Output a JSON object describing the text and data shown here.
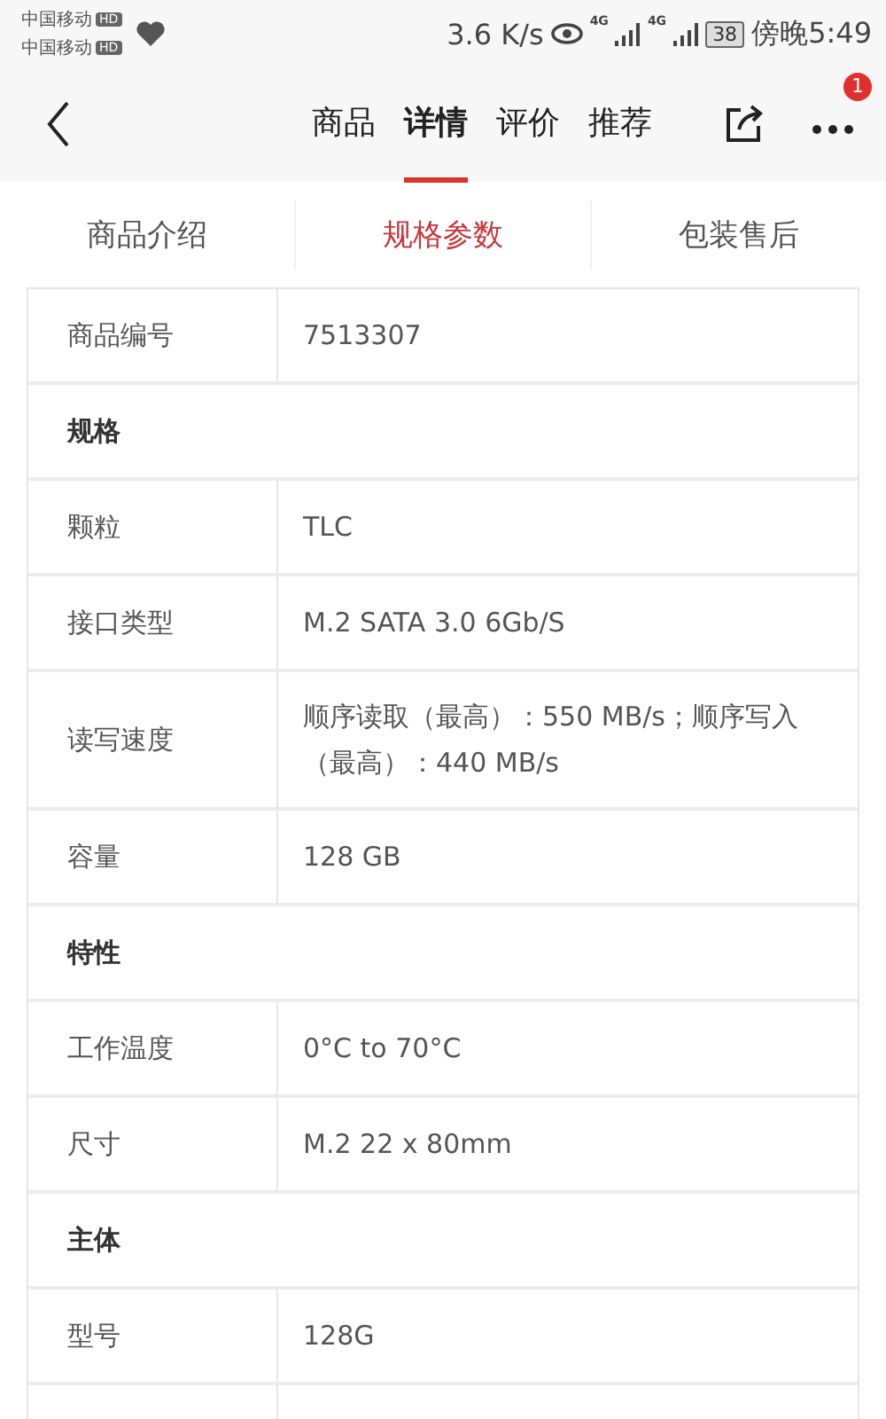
{
  "status_bar": {
    "carriers": [
      {
        "name": "中国移动",
        "badge": "HD"
      },
      {
        "name": "中国移动",
        "badge": "HD"
      }
    ],
    "speed": "3.6 K/s",
    "networks": [
      "4G",
      "4G"
    ],
    "battery": "38",
    "time": "傍晚5:49"
  },
  "nav": {
    "tabs": [
      {
        "label": "商品",
        "selected": false
      },
      {
        "label": "详情",
        "selected": true
      },
      {
        "label": "评价",
        "selected": false
      },
      {
        "label": "推荐",
        "selected": false
      }
    ],
    "more_badge": "1"
  },
  "sub_tabs": [
    {
      "label": "商品介绍",
      "selected": false
    },
    {
      "label": "规格参数",
      "selected": true
    },
    {
      "label": "包装售后",
      "selected": false
    }
  ],
  "table": {
    "rows": [
      {
        "kind": "pair",
        "label": "商品编号",
        "value": "7513307"
      },
      {
        "kind": "section",
        "label": "规格"
      },
      {
        "kind": "pair",
        "label": "颗粒",
        "value": "TLC"
      },
      {
        "kind": "pair",
        "label": "接口类型",
        "value": "M.2 SATA 3.0 6Gb/S"
      },
      {
        "kind": "pair",
        "label": "读写速度",
        "value": "顺序读取（最高）：550 MB/s；顺序写入（最高）：440 MB/s"
      },
      {
        "kind": "pair",
        "label": "容量",
        "value": "128 GB"
      },
      {
        "kind": "section",
        "label": "特性"
      },
      {
        "kind": "pair",
        "label": "工作温度",
        "value": "0°C to 70°C"
      },
      {
        "kind": "pair",
        "label": "尺寸",
        "value": "M.2 22 x 80mm"
      },
      {
        "kind": "section",
        "label": "主体"
      },
      {
        "kind": "pair",
        "label": "型号",
        "value": "128G"
      }
    ]
  }
}
